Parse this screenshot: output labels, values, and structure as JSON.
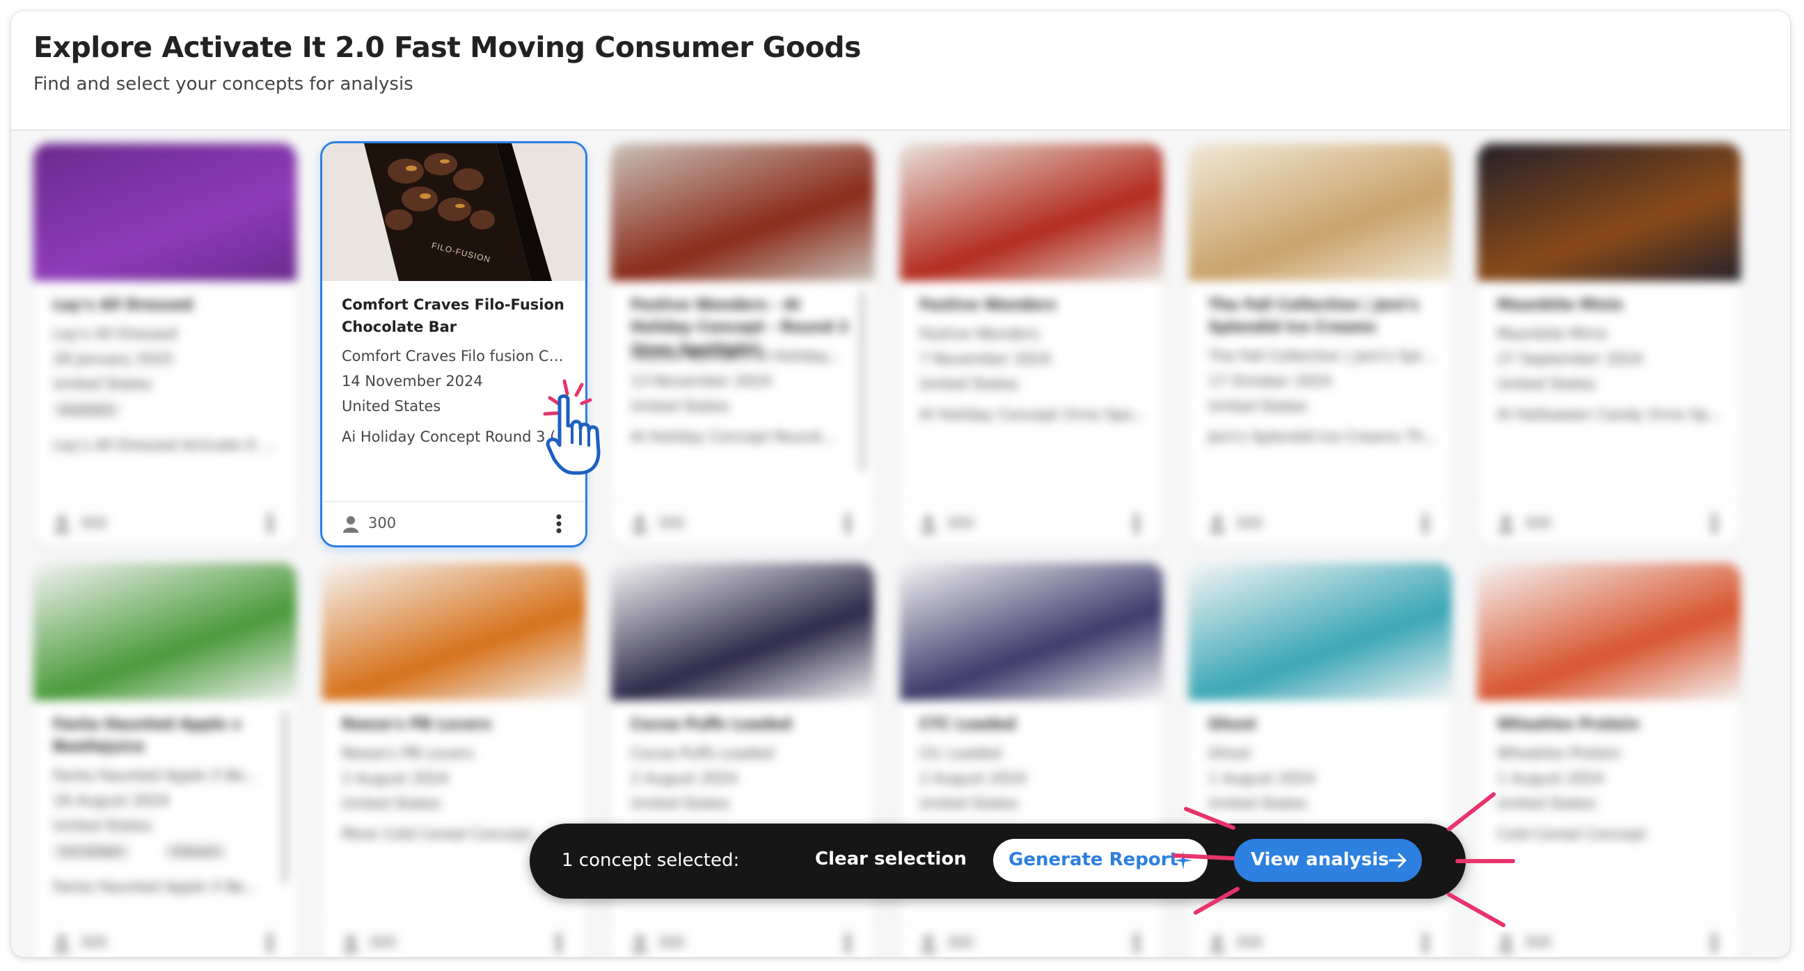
{
  "header": {
    "title": "Explore Activate It 2.0 Fast Moving Consumer Goods",
    "subtitle": "Find and select your concepts for analysis"
  },
  "cards_row1": [
    {
      "title": "Lay's All Dressed",
      "lines": [
        "Lay's All Dressed",
        "28 January 2025",
        "United States",
        "Lay's All Dressed Activate It 2.0"
      ],
      "tags": [
        "Newsletters"
      ],
      "count": "300"
    },
    {
      "title": "Comfort Craves Filo-Fusion Chocolate Bar",
      "lines": [
        "Comfort Craves Filo fusion Ch...",
        "14 November 2024",
        "United States",
        "Ai Holiday Concept Round 3 (i..."
      ],
      "tags": [],
      "count": "300",
      "selected": true
    },
    {
      "title": "Festive Wonders - AI Holiday Concept - Round 2 (Inno Spotlight)",
      "lines": [
        "Festive Wonders AI Holiday...",
        "13 November 2024",
        "United States",
        "AI Holiday Concept Round..."
      ],
      "tags": [],
      "count": "300"
    },
    {
      "title": "Festive Wonders",
      "lines": [
        "Festive Wonders",
        "7 November 2024",
        "United States",
        "AI Holiday Concept (Inno Spot..."
      ],
      "tags": [],
      "count": "300"
    },
    {
      "title": "The Fall Collection | Jeni's Splendid Ice Creams",
      "lines": [
        "The Fall Collection | Jeni's Spl...",
        "17 October 2024",
        "United States",
        "Jeni's Splendid Ice Creams Th..."
      ],
      "tags": [],
      "count": "300"
    },
    {
      "title": "Moonbite Minis",
      "lines": [
        "Moonbite Minis",
        "27 September 2024",
        "United States",
        "AI Halloween Candy (Inno Spo..."
      ],
      "tags": [],
      "count": "300"
    }
  ],
  "cards_row2": [
    {
      "title": "Fanta Haunted Apple x Beetlejuice",
      "lines": [
        "Fanta Haunted Apple X Be...",
        "16 August 2024",
        "United States",
        "Fanta Haunted Apple X Be..."
      ],
      "tags": [
        "Inno Spotlight",
        "Halloween"
      ],
      "count": "300"
    },
    {
      "title": "Reese's PB Lovers",
      "lines": [
        "Reese's PB Lovers",
        "2 August 2024",
        "United States",
        "More Cold Cereal Concept"
      ],
      "tags": [],
      "count": "300"
    },
    {
      "title": "Cocoa Puffs Loaded",
      "lines": [
        "Cocoa Puffs Loaded",
        "2 August 2024",
        "United States"
      ],
      "tags": [],
      "count": "300"
    },
    {
      "title": "CTC Loaded",
      "lines": [
        "Ctc Loaded",
        "2 August 2024",
        "United States"
      ],
      "tags": [],
      "count": "300"
    },
    {
      "title": "Ghost",
      "lines": [
        "Ghost",
        "1 August 2024",
        "United States"
      ],
      "tags": [],
      "count": "300"
    },
    {
      "title": "Wheaties Protein",
      "lines": [
        "Wheaties Protein",
        "1 August 2024",
        "United States",
        "Cold Cereal Concept"
      ],
      "tags": [],
      "count": "300"
    }
  ],
  "selected_card_image": {
    "brand_text": "FILO-FUSION"
  },
  "action_bar": {
    "selected_text": "1 concept selected:",
    "clear_label": "Clear selection",
    "generate_label": "Generate Report",
    "view_label": "View analysis"
  },
  "icons": {
    "person": "person-icon",
    "kebab": "kebab-icon",
    "sparkle": "sparkle-icon",
    "arrow": "arrow-right-icon",
    "pointer": "hand-pointer-icon"
  },
  "colors": {
    "accent": "#2d7fe0",
    "bar_bg": "#161616",
    "highlight": "#e8336b"
  }
}
